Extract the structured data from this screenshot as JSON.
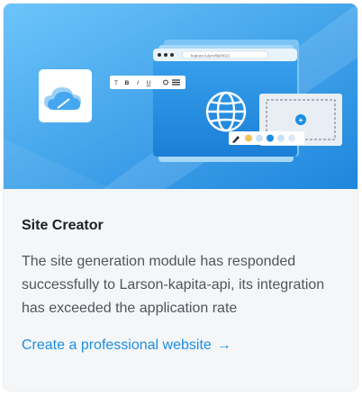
{
  "card": {
    "title": "Site Creator",
    "description": "The site generation module has responded successfully to Larson-kapita-api, its integration has exceeded the application rate",
    "link_label": "Create a professional website",
    "link_arrow": "→"
  },
  "illustration": {
    "url_bar_text": "feature.lu/profile/0021",
    "toolbar_buttons": [
      "T",
      "B",
      "I",
      "U"
    ],
    "add_symbol": "+",
    "palette_colors": [
      "#f2c35c",
      "#c9e2f8",
      "#1a8fe3",
      "#c9e2f8",
      "#dde9f6"
    ]
  },
  "colors": {
    "accent": "#1a8fe3",
    "hero_start": "#5bb8f5",
    "hero_end": "#1f84d9"
  }
}
